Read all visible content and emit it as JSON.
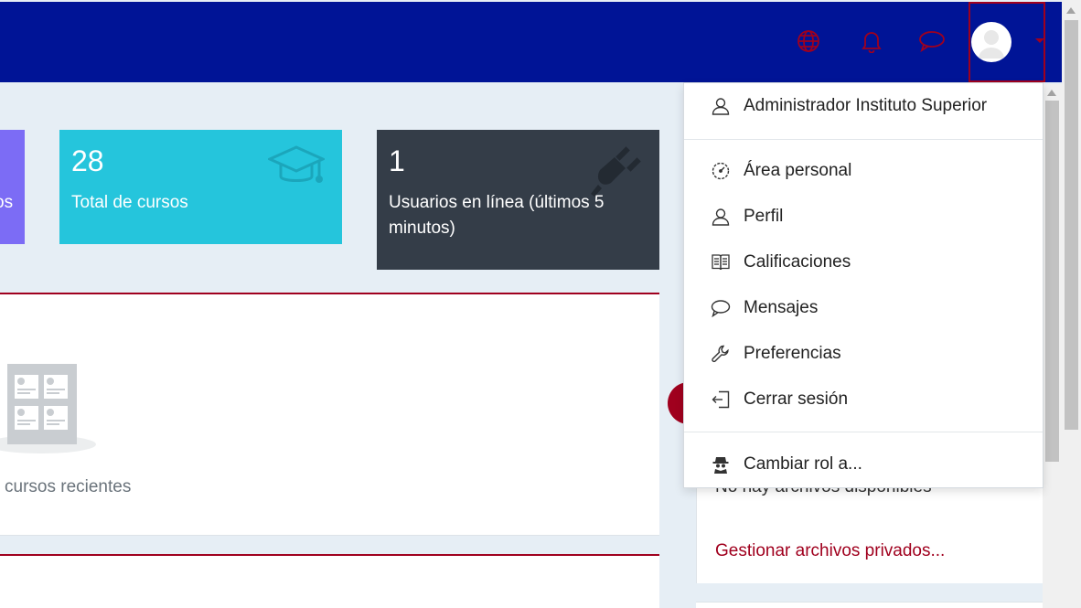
{
  "navbar": {
    "icons": [
      "language-icon",
      "bell-icon",
      "chat-icon"
    ],
    "accent": "#a0001e",
    "background": "#001496"
  },
  "cards": {
    "purple_label": "os",
    "cyan": {
      "number": "28",
      "label": "Total de cursos",
      "icon": "graduation-cap-icon"
    },
    "dark": {
      "number": "1",
      "label": "Usuarios en línea (últimos 5 minutos)",
      "icon": "plug-icon"
    }
  },
  "recent": {
    "empty_text": "cursos recientes"
  },
  "side": {
    "files_text": "No hay archivos disponibles",
    "manage_link": "Gestionar archivos privados..."
  },
  "user_menu": {
    "items": [
      {
        "label": "Administrador Instituto Superior",
        "icon": "user-icon"
      },
      {
        "label": "Área personal",
        "icon": "dashboard-icon"
      },
      {
        "label": "Perfil",
        "icon": "user-icon"
      },
      {
        "label": "Calificaciones",
        "icon": "grades-book-icon"
      },
      {
        "label": "Mensajes",
        "icon": "message-icon"
      },
      {
        "label": "Preferencias",
        "icon": "wrench-icon"
      },
      {
        "label": "Cerrar sesión",
        "icon": "logout-icon"
      },
      {
        "label": "Cambiar rol a...",
        "icon": "spy-icon"
      }
    ]
  }
}
